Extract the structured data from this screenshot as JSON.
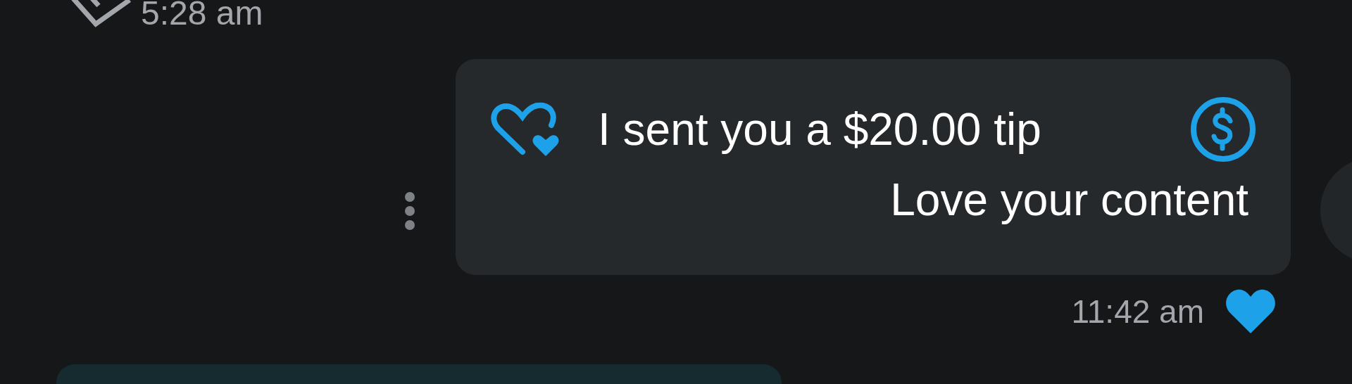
{
  "previous_message": {
    "time": "5:28 am",
    "read": true
  },
  "tip_message": {
    "title": "I sent you a $20.00 tip",
    "text": "Love your content",
    "liked": true,
    "time": "11:42 am"
  }
}
